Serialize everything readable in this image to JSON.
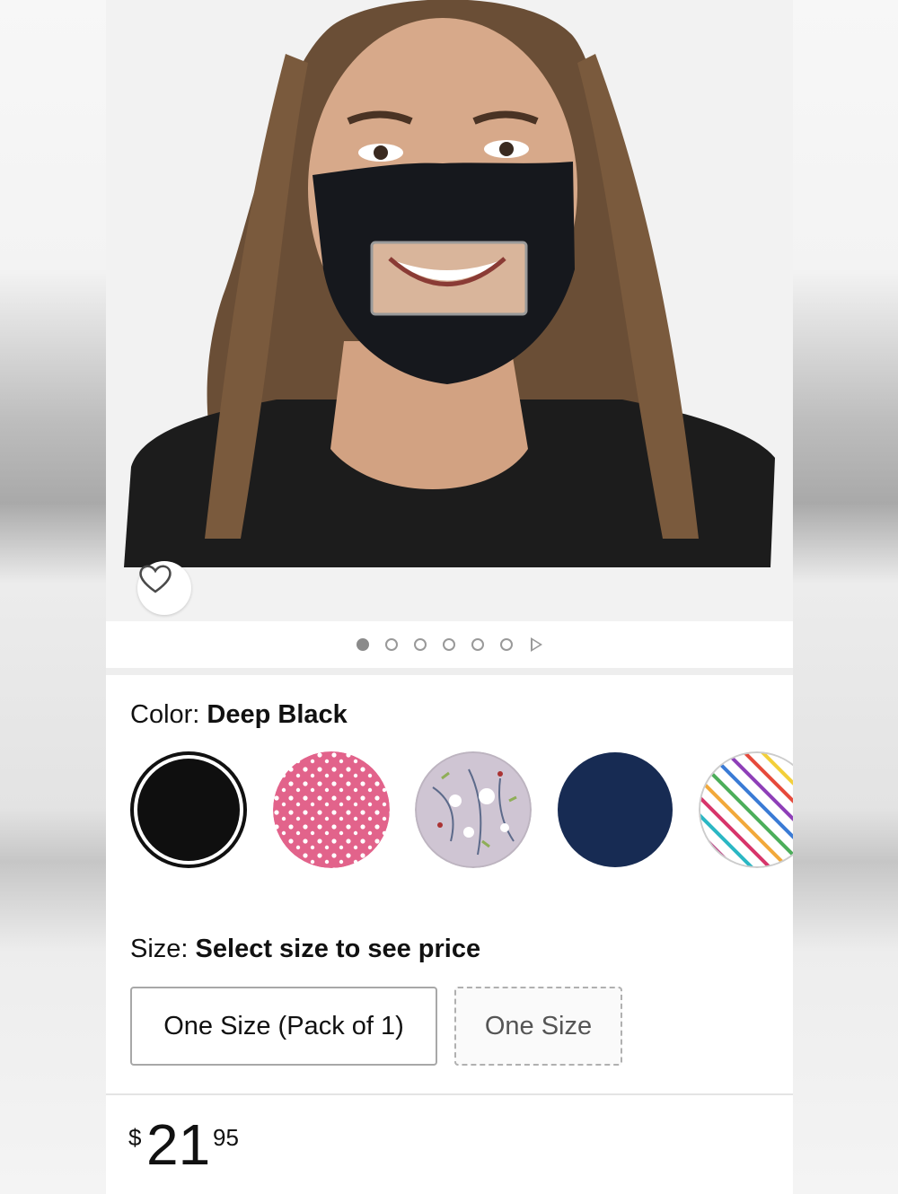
{
  "product": {
    "image_alt": "Clear window face mask",
    "wishlist_icon": "heart-outline-icon",
    "gallery": {
      "total_dots": 6,
      "active_index": 0,
      "next_icon": "play-triangle-icon"
    }
  },
  "variation": {
    "color": {
      "label": "Color:",
      "selected": "Deep Black",
      "swatches": [
        {
          "name": "Deep Black",
          "color": "#0f0f0f",
          "selected": true
        },
        {
          "name": "Pink Dots",
          "color": "#e2638b"
        },
        {
          "name": "Floral",
          "color": "#cfc5d3"
        },
        {
          "name": "Navy",
          "color": "#172b53"
        },
        {
          "name": "Stripes",
          "color": "#ffffff"
        }
      ]
    },
    "size": {
      "label": "Size:",
      "selected": "Select size to see price",
      "options": [
        "One Size (Pack of 1)",
        "One Size"
      ]
    }
  },
  "price": {
    "currency": "$",
    "whole": "21",
    "fraction": "95"
  }
}
